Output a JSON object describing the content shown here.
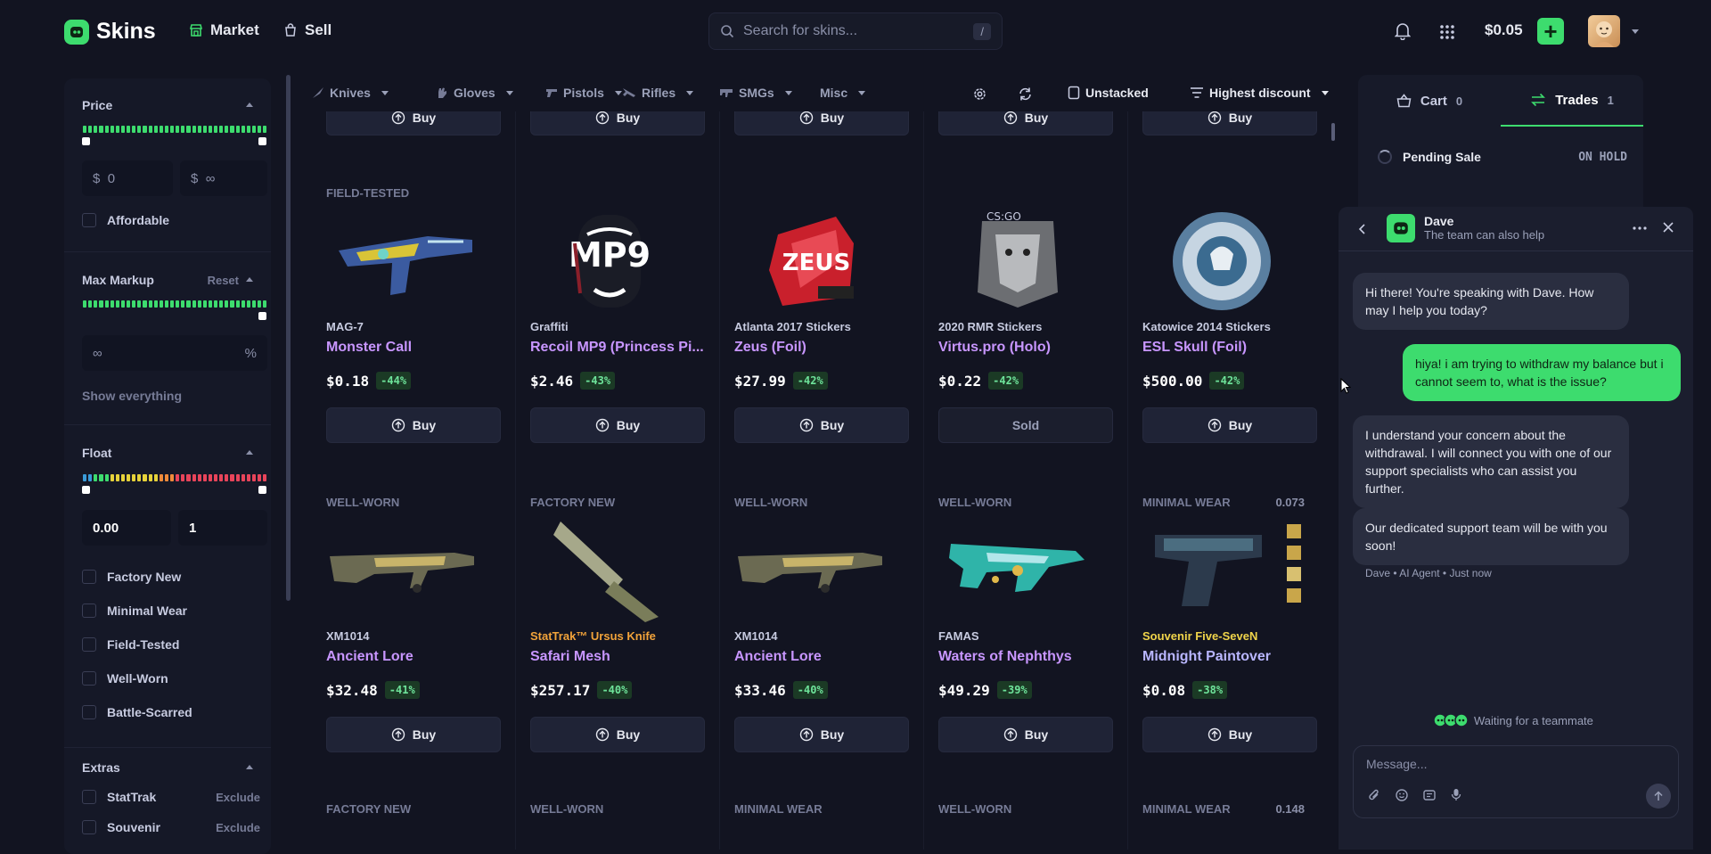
{
  "app": {
    "name": "Skins"
  },
  "nav": {
    "market": "Market",
    "sell": "Sell"
  },
  "search": {
    "placeholder": "Search for skins...",
    "shortcut": "/"
  },
  "header": {
    "balance": "$0.05",
    "plus": "+"
  },
  "sidebar": {
    "price": {
      "title": "Price",
      "min_prefix": "$",
      "min_value": "0",
      "max_prefix": "$",
      "max_value": "∞",
      "affordable": "Affordable"
    },
    "max_markup": {
      "title": "Max Markup",
      "reset": "Reset",
      "value": "∞",
      "unit": "%",
      "show_everything": "Show everything"
    },
    "float": {
      "title": "Float",
      "min": "0.00",
      "max": "1",
      "options": [
        "Factory New",
        "Minimal Wear",
        "Field-Tested",
        "Well-Worn",
        "Battle-Scarred"
      ]
    },
    "extras": {
      "title": "Extras",
      "items": [
        {
          "label": "StatTrak",
          "action": "Exclude"
        },
        {
          "label": "Souvenir",
          "action": "Exclude"
        }
      ]
    }
  },
  "filters": {
    "categories": [
      "Knives",
      "Gloves",
      "Pistols",
      "Rifles",
      "SMGs",
      "Misc"
    ],
    "unstacked": "Unstacked",
    "sort": "Highest discount"
  },
  "grid": {
    "top_row_button": "Buy",
    "row1": [
      {
        "condition": "FIELD-TESTED",
        "category": "MAG-7",
        "name": "Monster Call",
        "price": "$0.18",
        "discount": "-44%",
        "button": "Buy"
      },
      {
        "condition": "",
        "category": "Graffiti",
        "name": "Recoil MP9 (Princess Pi...",
        "price": "$2.46",
        "discount": "-43%",
        "button": "Buy"
      },
      {
        "condition": "",
        "category": "Atlanta 2017 Stickers",
        "name": "Zeus (Foil)",
        "price": "$27.99",
        "discount": "-42%",
        "button": "Buy"
      },
      {
        "condition": "",
        "category": "2020 RMR Stickers",
        "name": "Virtus.pro (Holo)",
        "price": "$0.22",
        "discount": "-42%",
        "button": "Sold"
      },
      {
        "condition": "",
        "category": "Katowice 2014 Stickers",
        "name": "ESL Skull (Foil)",
        "price": "$500.00",
        "discount": "-42%",
        "button": "Buy"
      }
    ],
    "row2": [
      {
        "condition": "WELL-WORN",
        "float": "",
        "category": "XM1014",
        "name": "Ancient Lore",
        "price": "$32.48",
        "discount": "-41%",
        "button": "Buy"
      },
      {
        "condition": "FACTORY NEW",
        "float": "",
        "category": "StatTrak™ Ursus Knife",
        "name": "Safari Mesh",
        "price": "$257.17",
        "discount": "-40%",
        "button": "Buy"
      },
      {
        "condition": "WELL-WORN",
        "float": "",
        "category": "XM1014",
        "name": "Ancient Lore",
        "price": "$33.46",
        "discount": "-40%",
        "button": "Buy"
      },
      {
        "condition": "WELL-WORN",
        "float": "",
        "category": "FAMAS",
        "name": "Waters of Nephthys",
        "price": "$49.29",
        "discount": "-39%",
        "button": "Buy"
      },
      {
        "condition": "MINIMAL WEAR",
        "float": "0.073",
        "category": "Souvenir Five-SeveN",
        "name": "Midnight Paintover",
        "price": "$0.08",
        "discount": "-38%",
        "button": "Buy"
      }
    ],
    "row3": [
      {
        "condition": "FACTORY NEW",
        "float": ""
      },
      {
        "condition": "WELL-WORN",
        "float": ""
      },
      {
        "condition": "MINIMAL WEAR",
        "float": ""
      },
      {
        "condition": "WELL-WORN",
        "float": ""
      },
      {
        "condition": "MINIMAL WEAR",
        "float": "0.148"
      }
    ]
  },
  "right_panel": {
    "cart_label": "Cart",
    "cart_count": "0",
    "trades_label": "Trades",
    "trades_count": "1",
    "pending_label": "Pending Sale",
    "pending_status": "ON HOLD"
  },
  "chat": {
    "agent_name": "Dave",
    "agent_subtitle": "The team can also help",
    "messages": [
      {
        "from": "bot",
        "text": "Hi there! You're speaking with Dave. How may I help you today?"
      },
      {
        "from": "user",
        "text": "hiya! i am trying to withdraw my balance but i cannot seem to, what is the issue?"
      },
      {
        "from": "bot",
        "text": "I understand your concern about the withdrawal. I will connect you with one of our support specialists who can assist you further."
      },
      {
        "from": "bot",
        "text": "Our dedicated support team will be with you soon!"
      }
    ],
    "meta": "Dave • AI Agent • Just now",
    "waiting": "Waiting for a teammate",
    "input_placeholder": "Message..."
  },
  "colors": {
    "accent": "#3ddc6e",
    "background": "#121421",
    "panel": "#151827",
    "purple_name": "#c896ff",
    "stattrak": "#f2a33a",
    "souvenir": "#f0d44a",
    "discount_bg": "#1b3a25"
  }
}
